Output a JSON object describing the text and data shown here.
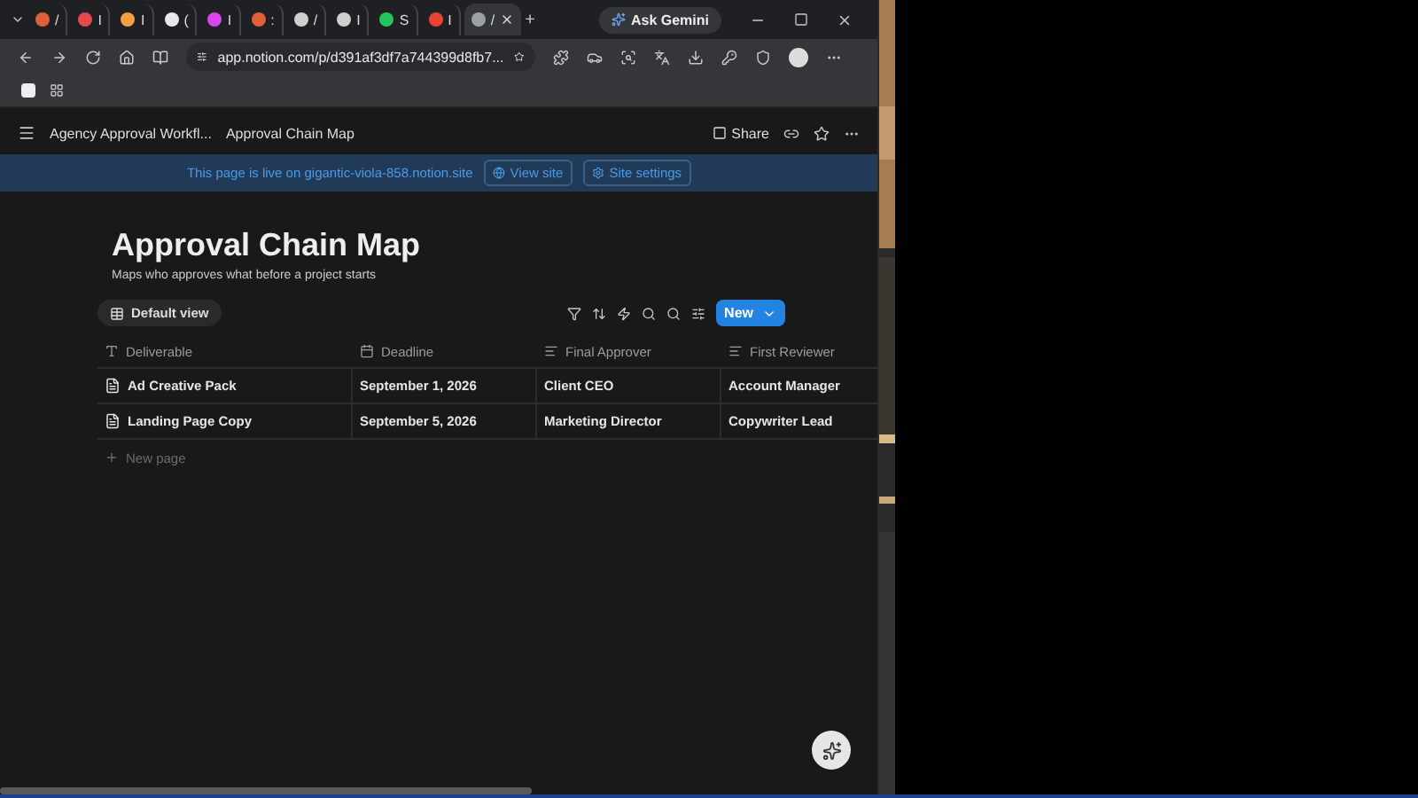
{
  "browser": {
    "tabs": [
      {
        "label": "/",
        "color": "#e0603a",
        "selected": false
      },
      {
        "label": "I",
        "color": "#e5484d",
        "selected": false
      },
      {
        "label": "I",
        "color": "#f2a03d",
        "selected": false
      },
      {
        "label": "(",
        "color": "#e8e8e8",
        "selected": false
      },
      {
        "label": "I",
        "color": "#d946ef",
        "selected": false
      },
      {
        "label": ":",
        "color": "#e0603a",
        "selected": false
      },
      {
        "label": "/",
        "color": "#cfcfcf",
        "selected": false
      },
      {
        "label": "I",
        "color": "#cfcfcf",
        "selected": false
      },
      {
        "label": "S",
        "color": "#22c55e",
        "selected": false
      },
      {
        "label": "I",
        "color": "#ea4335",
        "selected": false
      },
      {
        "label": "/",
        "color": "#9aa0a6",
        "selected": true
      }
    ],
    "new_tab": "+",
    "gemini": "Ask Gemini",
    "url": "app.notion.com/p/d391af3df7a744399d8fb7..."
  },
  "topbar": {
    "breadcrumbs": [
      "Agency Approval Workfl...",
      "Approval Chain Map"
    ],
    "share": "Share"
  },
  "banner": {
    "text": "This page is live on gigantic-viola-858.notion.site",
    "buttons": [
      "View site",
      "Site settings"
    ]
  },
  "page": {
    "title": "Approval Chain Map",
    "description": "Maps who approves what before a project starts"
  },
  "view": {
    "label": "Default view",
    "new_button": "New"
  },
  "table": {
    "columns": [
      {
        "label": "Deliverable",
        "kind": "title"
      },
      {
        "label": "Deadline",
        "kind": "date"
      },
      {
        "label": "Final Approver",
        "kind": "text"
      },
      {
        "label": "First Reviewer",
        "kind": "text"
      }
    ],
    "rows": [
      [
        "Ad Creative Pack",
        "September 1, 2026",
        "Client CEO",
        "Account Manager"
      ],
      [
        "Landing Page Copy",
        "September 5, 2026",
        "Marketing Director",
        "Copywriter Lead"
      ]
    ],
    "new_row": "New page"
  }
}
